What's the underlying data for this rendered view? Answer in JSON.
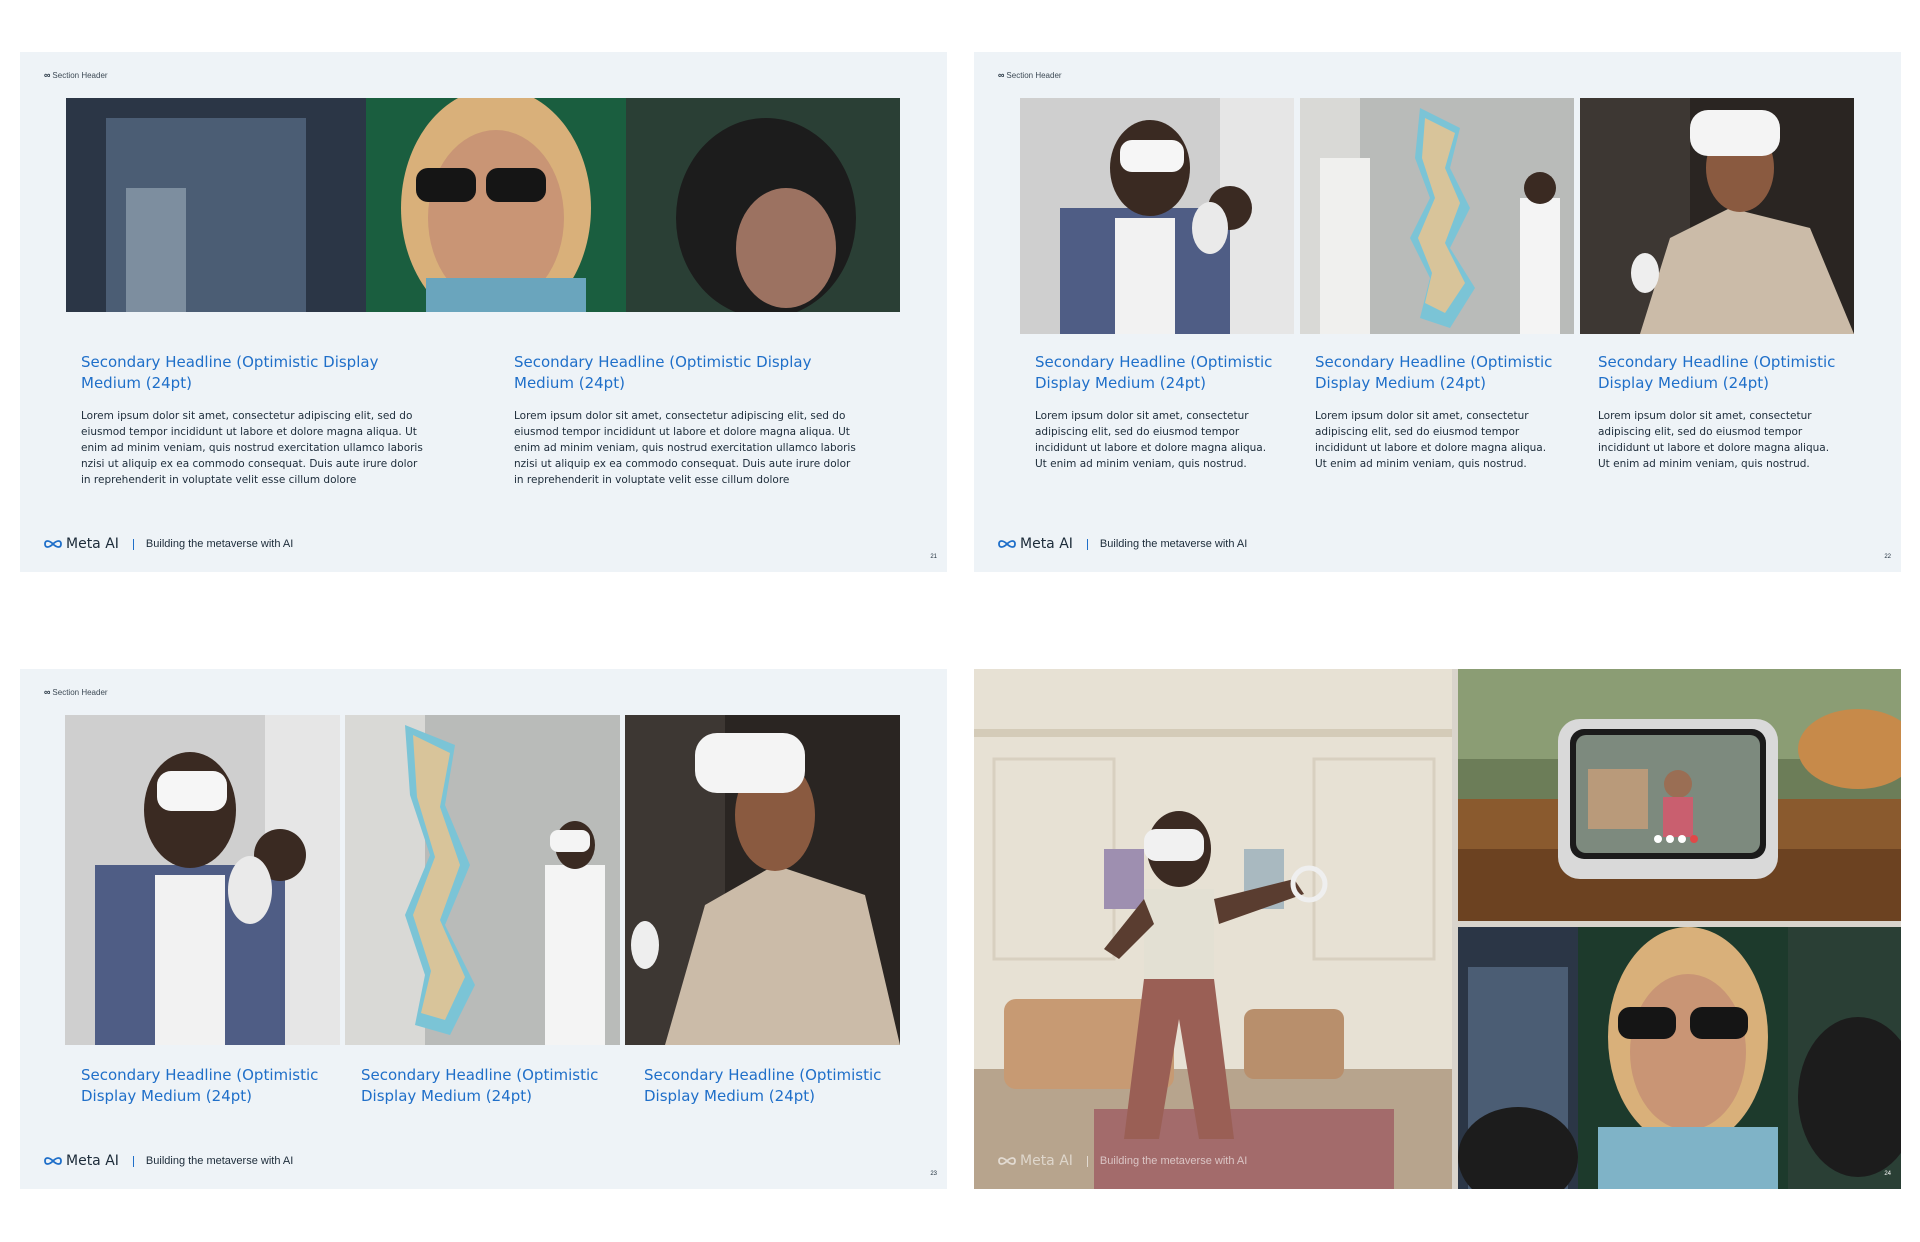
{
  "slides": [
    {
      "section_header": "Section Header",
      "columns": [
        {
          "headline": "Secondary Headline (Optimistic Display Medium (24pt)",
          "body": "Lorem ipsum dolor sit amet, consectetur adipiscing elit, sed do eiusmod tempor incididunt ut labore et dolore magna aliqua. Ut enim ad minim veniam, quis nostrud exercitation ullamco laboris nzisi ut aliquip ex ea commodo consequat. Duis aute irure dolor in reprehenderit in voluptate velit esse cillum dolore"
        },
        {
          "headline": "Secondary Headline (Optimistic Display Medium (24pt)",
          "body": "Lorem ipsum dolor sit amet, consectetur adipiscing elit, sed do eiusmod tempor incididunt ut labore et dolore magna aliqua. Ut enim ad minim veniam, quis nostrud exercitation ullamco laboris nzisi ut aliquip ex ea commodo consequat. Duis aute irure dolor in reprehenderit in voluptate velit esse cillum dolore"
        }
      ],
      "brand": "Meta AI",
      "tagline": "Building the metaverse with AI",
      "page": "21"
    },
    {
      "section_header": "Section Header",
      "columns": [
        {
          "headline": "Secondary Headline (Optimistic Display Medium (24pt)",
          "body": "Lorem ipsum dolor sit amet, consectetur adipiscing elit, sed do eiusmod tempor incididunt ut labore et dolore magna aliqua. Ut enim ad minim veniam, quis nostrud."
        },
        {
          "headline": "Secondary Headline (Optimistic Display Medium (24pt)",
          "body": "Lorem ipsum dolor sit amet, consectetur adipiscing elit, sed do eiusmod tempor incididunt ut labore et dolore magna aliqua. Ut enim ad minim veniam, quis nostrud."
        },
        {
          "headline": "Secondary Headline (Optimistic Display Medium (24pt)",
          "body": "Lorem ipsum dolor sit amet, consectetur adipiscing elit, sed do eiusmod tempor incididunt ut labore et dolore magna aliqua. Ut enim ad minim veniam, quis nostrud."
        }
      ],
      "brand": "Meta AI",
      "tagline": "Building the metaverse with AI",
      "page": "22"
    },
    {
      "section_header": "Section Header",
      "columns": [
        {
          "headline": "Secondary Headline (Optimistic Display Medium (24pt)"
        },
        {
          "headline": "Secondary Headline (Optimistic Display Medium (24pt)"
        },
        {
          "headline": "Secondary Headline (Optimistic Display Medium (24pt)"
        }
      ],
      "brand": "Meta AI",
      "tagline": "Building the metaverse with AI",
      "page": "23"
    },
    {
      "brand": "Meta AI",
      "tagline": "Building the metaverse with AI",
      "page": "24"
    }
  ],
  "colors": {
    "accent": "#1f6fc9",
    "slide_bg": "#eef3f7",
    "text": "#1c2b39"
  }
}
